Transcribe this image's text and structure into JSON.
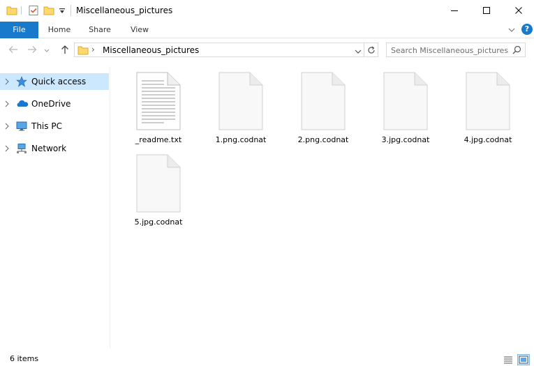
{
  "window": {
    "title": "Miscellaneous_pictures",
    "minimize_glyph": "—",
    "maximize_glyph": "☐",
    "close_glyph": "✕"
  },
  "ribbon": {
    "tabs": [
      {
        "label": "File"
      },
      {
        "label": "Home"
      },
      {
        "label": "Share"
      },
      {
        "label": "View"
      }
    ],
    "help_glyph": "?"
  },
  "address": {
    "separator": "›",
    "path": "Miscellaneous_pictures"
  },
  "search": {
    "placeholder": "Search Miscellaneous_pictures"
  },
  "navpane": {
    "items": [
      {
        "label": "Quick access",
        "icon": "star-icon",
        "selected": true
      },
      {
        "label": "OneDrive",
        "icon": "cloud-icon"
      },
      {
        "label": "This PC",
        "icon": "monitor-icon"
      },
      {
        "label": "Network",
        "icon": "network-icon"
      }
    ]
  },
  "files": [
    {
      "name": "_readme.txt",
      "icon": "text-file-icon"
    },
    {
      "name": "1.png.codnat",
      "icon": "blank-file-icon"
    },
    {
      "name": "2.png.codnat",
      "icon": "blank-file-icon"
    },
    {
      "name": "3.jpg.codnat",
      "icon": "blank-file-icon"
    },
    {
      "name": "4.jpg.codnat",
      "icon": "blank-file-icon"
    },
    {
      "name": "5.jpg.codnat",
      "icon": "blank-file-icon"
    }
  ],
  "status": {
    "item_count": "6 items"
  },
  "colors": {
    "file_tab": "#1979ca",
    "selection": "#cce8ff",
    "folder": "#ffd970",
    "help": "#1979ca"
  }
}
